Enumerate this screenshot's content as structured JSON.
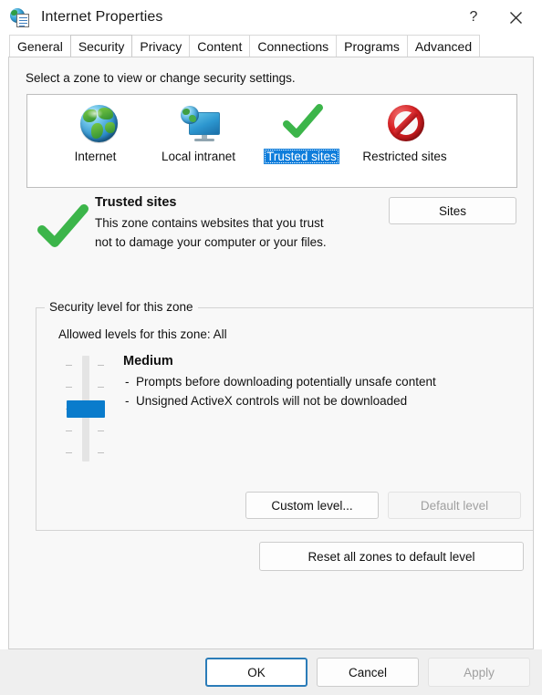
{
  "window": {
    "title": "Internet Properties",
    "icon": "internet-properties-icon",
    "help_label": "?",
    "close_label": "✕"
  },
  "tabs": [
    {
      "label": "General",
      "active": false
    },
    {
      "label": "Security",
      "active": true
    },
    {
      "label": "Privacy",
      "active": false
    },
    {
      "label": "Content",
      "active": false
    },
    {
      "label": "Connections",
      "active": false
    },
    {
      "label": "Programs",
      "active": false
    },
    {
      "label": "Advanced",
      "active": false
    }
  ],
  "security": {
    "intro": "Select a zone to view or change security settings.",
    "zones": [
      {
        "label": "Internet",
        "icon": "globe-icon",
        "selected": false
      },
      {
        "label": "Local intranet",
        "icon": "monitor-globe-icon",
        "selected": false
      },
      {
        "label": "Trusted sites",
        "icon": "green-check-icon",
        "selected": true
      },
      {
        "label": "Restricted sites",
        "icon": "red-prohibition-icon",
        "selected": false
      }
    ],
    "zone_detail": {
      "icon": "green-check-icon",
      "title": "Trusted sites",
      "description": "This zone contains websites that you trust not to damage your computer or your files.",
      "sites_button": "Sites"
    },
    "level_group": {
      "title": "Security level for this zone",
      "allowed_levels": "Allowed levels for this zone: All",
      "level_name": "Medium",
      "level_bullets": [
        "Prompts before downloading potentially unsafe content",
        "Unsigned ActiveX controls will not be downloaded"
      ],
      "slider": {
        "tick_count": 5,
        "position_index": 2,
        "thumb_color": "#0a7ccc"
      },
      "custom_level_button": "Custom level...",
      "default_level_button": "Default level",
      "default_level_disabled": true
    },
    "reset_button": "Reset all zones to default level"
  },
  "footer": {
    "ok": "OK",
    "cancel": "Cancel",
    "apply": "Apply",
    "apply_disabled": true
  },
  "colors": {
    "accent": "#0f7ddb",
    "selection": "#0f7ddb",
    "slider": "#0a7ccc",
    "check_green": "#3cb54a",
    "ban_red": "#d81f22",
    "default_border": "#2b7cb8"
  }
}
